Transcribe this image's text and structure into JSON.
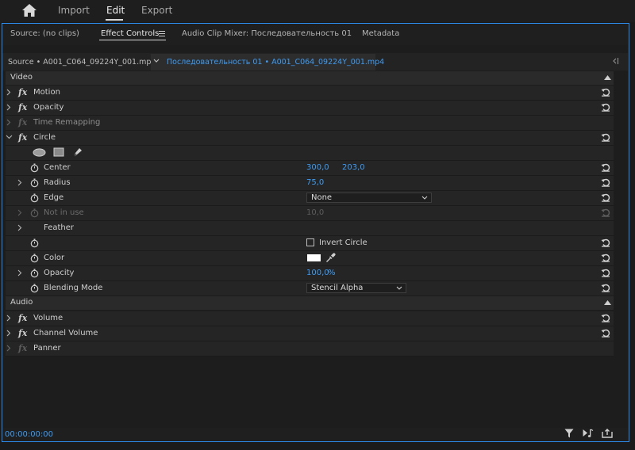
{
  "app_bar": {
    "workspaces": [
      "Import",
      "Edit",
      "Export"
    ],
    "active_workspace": "Edit"
  },
  "panel_tabs": {
    "source": "Source: (no clips)",
    "effect_controls": "Effect Controls",
    "audio_clip_mixer": "Audio Clip Mixer: Последовательность 01",
    "metadata": "Metadata"
  },
  "clip_header": {
    "source": "Source • A001_C064_09224Y_001.mp4",
    "sequence": "Последовательность 01 • A001_C064_09224Y_001.mp4"
  },
  "sections": {
    "video": "Video",
    "audio": "Audio"
  },
  "video_effects": {
    "motion": "Motion",
    "opacity": "Opacity",
    "time_remapping": "Time Remapping",
    "circle": "Circle"
  },
  "circle": {
    "center": {
      "label": "Center",
      "x": "300,0",
      "y": "203,0"
    },
    "radius": {
      "label": "Radius",
      "value": "75,0"
    },
    "edge": {
      "label": "Edge",
      "selected": "None"
    },
    "not_in_use": {
      "label": "Not in use",
      "value": "10,0"
    },
    "feather": {
      "label": "Feather"
    },
    "invert": {
      "label": "Invert Circle",
      "checked": false
    },
    "color": {
      "label": "Color",
      "swatch": "#ffffff"
    },
    "opacity": {
      "label": "Opacity",
      "value": "100,0",
      "unit": "%"
    },
    "blending": {
      "label": "Blending Mode",
      "selected": "Stencil Alpha"
    }
  },
  "audio_effects": {
    "volume": "Volume",
    "channel_volume": "Channel Volume",
    "panner": "Panner"
  },
  "footer": {
    "timecode": "00:00:00:00"
  },
  "icons": {
    "home": "home-icon",
    "panel_menu": "hamburger-menu-icon",
    "reset": "reset-parameter-icon",
    "stopwatch": "stopwatch-icon",
    "chevron": "chevron-right-icon",
    "ellipse": "ellipse-mask-icon",
    "rectangle": "rectangle-mask-icon",
    "pen": "pen-mask-icon",
    "eyedropper": "eyedropper-icon",
    "filter": "filter-icon",
    "play_audio": "play-audio-icon",
    "export": "export-frame-icon"
  },
  "colors": {
    "accent_blue": "#3e9bf3",
    "panel_border": "#2d8ceb"
  }
}
